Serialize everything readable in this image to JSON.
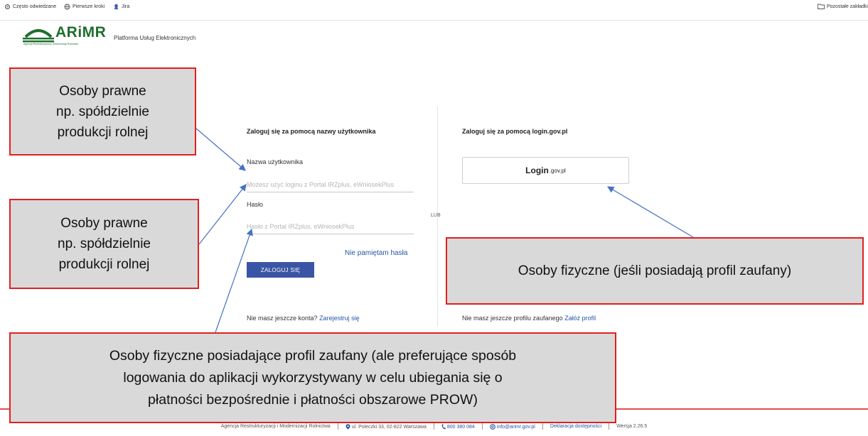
{
  "bookmarks": {
    "items": [
      "Często odwiedzane",
      "Pierwsze kroki",
      "Jira"
    ],
    "other": "Pozostałe zakładki"
  },
  "header": {
    "logo_text": "ARiMR",
    "logo_sub": "Agencja Restrukturyzacji i Modernizacji Rolnictwa",
    "platform": "Platforma Usług Elektronicznych"
  },
  "login_user": {
    "title": "Zaloguj się za pomocą nazwy użytkownika",
    "username_label": "Nazwa użytkownika",
    "username_placeholder": "Możesz użyć loginu z Portal IRZplus, eWniosekPlus",
    "password_label": "Hasło",
    "password_placeholder": "Hasło z Portal IRZplus, eWniosekPlus",
    "forgot": "Nie pamiętam hasła",
    "login_button": "ZALOGUJ SIĘ",
    "no_account": "Nie masz jeszcze konta?",
    "register": "Zarejestruj się"
  },
  "divider_label": "LUB",
  "login_gov": {
    "title": "Zaloguj się za pomocą login.gov.pl",
    "button_main": "Login",
    "button_domain": ".gov.pl",
    "no_profile": "Nie masz jeszcze profilu zaufanego",
    "create_profile": "Załóż profil"
  },
  "footer": {
    "agency": "Agencja Restrukturyzacji i Modernizacji Rolnictwa",
    "address": "ul. Poleczki 33, 02-822 Warszawa",
    "phone": "800 380 084",
    "email": "info@arimr.gov.pl",
    "accessibility": "Deklaracja dostępności",
    "version": "Wersja 2.26.5"
  },
  "callouts": {
    "legal_1": [
      "Osoby  prawne",
      "np. spółdzielnie",
      "produkcji rolnej"
    ],
    "legal_2": [
      "Osoby  prawne",
      "np. spółdzielnie",
      "produkcji rolnej"
    ],
    "natural_trusted": "Osoby fizyczne (jeśli posiadają profil zaufany)",
    "natural_preferring": [
      "Osoby fizyczne posiadające profil zaufany (ale preferujące sposób",
      "logowania do aplikacji  wykorzystywany w celu ubiegania się o",
      "płatności bezpośrednie i płatności obszarowe PROW)"
    ]
  },
  "colors": {
    "brand_green": "#1f6e2f",
    "button_blue": "#3a55a4",
    "link_blue": "#2456a6",
    "callout_border": "#e0201f",
    "callout_fill": "#d9d9d9",
    "arrow": "#4472c4"
  }
}
